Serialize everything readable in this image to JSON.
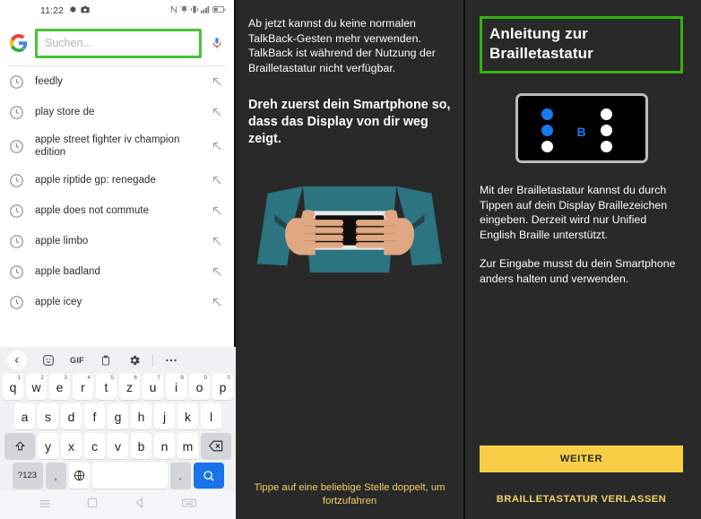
{
  "left_panel": {
    "status_bar": {
      "time": "11:22",
      "left_icons": [
        "gear-icon",
        "camera-icon"
      ],
      "right_icons": [
        "nfc-icon",
        "alarm-icon",
        "vibrate-icon",
        "signal-icon",
        "battery-icon"
      ]
    },
    "search": {
      "logo": "google-logo",
      "placeholder": "Suchen...",
      "value": "",
      "mic": "microphone-icon",
      "focus_border_color": "#4cc238"
    },
    "suggestions": [
      {
        "text": "feedly"
      },
      {
        "text": "play store de"
      },
      {
        "text": "apple street fighter iv champion edition"
      },
      {
        "text": "apple riptide gp: renegade"
      },
      {
        "text": "apple does not commute"
      },
      {
        "text": "apple limbo"
      },
      {
        "text": "apple badland"
      },
      {
        "text": "apple icey"
      }
    ],
    "keyboard": {
      "toolbar": [
        {
          "name": "back-chevron",
          "label": "‹"
        },
        {
          "name": "sticker-icon",
          "label": "☺"
        },
        {
          "name": "gif-icon",
          "label": "GIF"
        },
        {
          "name": "clipboard-icon",
          "label": "ὌB"
        },
        {
          "name": "settings-gear-icon",
          "label": "⚙"
        },
        {
          "name": "more-options-icon",
          "label": "•••"
        }
      ],
      "row1": [
        {
          "key": "q",
          "num": "1"
        },
        {
          "key": "w",
          "num": "2"
        },
        {
          "key": "e",
          "num": "3"
        },
        {
          "key": "r",
          "num": "4"
        },
        {
          "key": "t",
          "num": "5"
        },
        {
          "key": "z",
          "num": "6"
        },
        {
          "key": "u",
          "num": "7"
        },
        {
          "key": "i",
          "num": "8"
        },
        {
          "key": "o",
          "num": "9"
        },
        {
          "key": "p",
          "num": "0"
        }
      ],
      "row2": [
        "a",
        "s",
        "d",
        "f",
        "g",
        "h",
        "j",
        "k",
        "l"
      ],
      "row3": [
        "y",
        "x",
        "c",
        "v",
        "b",
        "n",
        "m"
      ],
      "shift_label": "⇧",
      "backspace_label": "⌫",
      "symbols_label": "?123",
      "comma_label": ",",
      "globe_label": "ἱ0",
      "space_label": "",
      "period_label": ".",
      "enter_label": "search-icon"
    },
    "nav_bar": [
      "menu-icon",
      "home-icon",
      "back-icon",
      "keyboard-icon"
    ]
  },
  "middle_panel": {
    "intro": "Ab jetzt kannst du keine normalen TalkBack-Gesten mehr verwenden. TalkBack ist während der Nutzung der Brailletastatur nicht verfügbar.",
    "heading": "Dreh zuerst dein Smartphone so, dass das Display von dir weg zeigt.",
    "illustration": "person-holding-phone-landscape-illustration",
    "footer": "Tippe auf eine beliebige Stelle doppelt, um fortzufahren",
    "footer_color": "#f3d268",
    "background_color": "#292929"
  },
  "right_panel": {
    "title": "Anleitung zur Brailletastatur",
    "title_focus_border_color": "#36b011",
    "braille_card": {
      "letter": "B",
      "dots": [
        {
          "position": "dot-1",
          "filled": true
        },
        {
          "position": "dot-4",
          "filled": false
        },
        {
          "position": "dot-2",
          "filled": true
        },
        {
          "position": "dot-5",
          "filled": false
        },
        {
          "position": "dot-3",
          "filled": false
        },
        {
          "position": "dot-6",
          "filled": false
        }
      ],
      "active_color": "#1878f0"
    },
    "body_paragraph_1": "Mit der Brailletastatur kannst du durch Tippen auf dein Display Braillezeichen eingeben. Derzeit wird nur Unified English Braille unterstützt.",
    "body_paragraph_2": "Zur Eingabe musst du dein Smartphone anders halten und verwenden.",
    "primary_button": "WEITER",
    "primary_button_color": "#f7cf46",
    "secondary_button": "BRAILLETASTATUR VERLASSEN",
    "secondary_button_color": "#f3d268"
  }
}
